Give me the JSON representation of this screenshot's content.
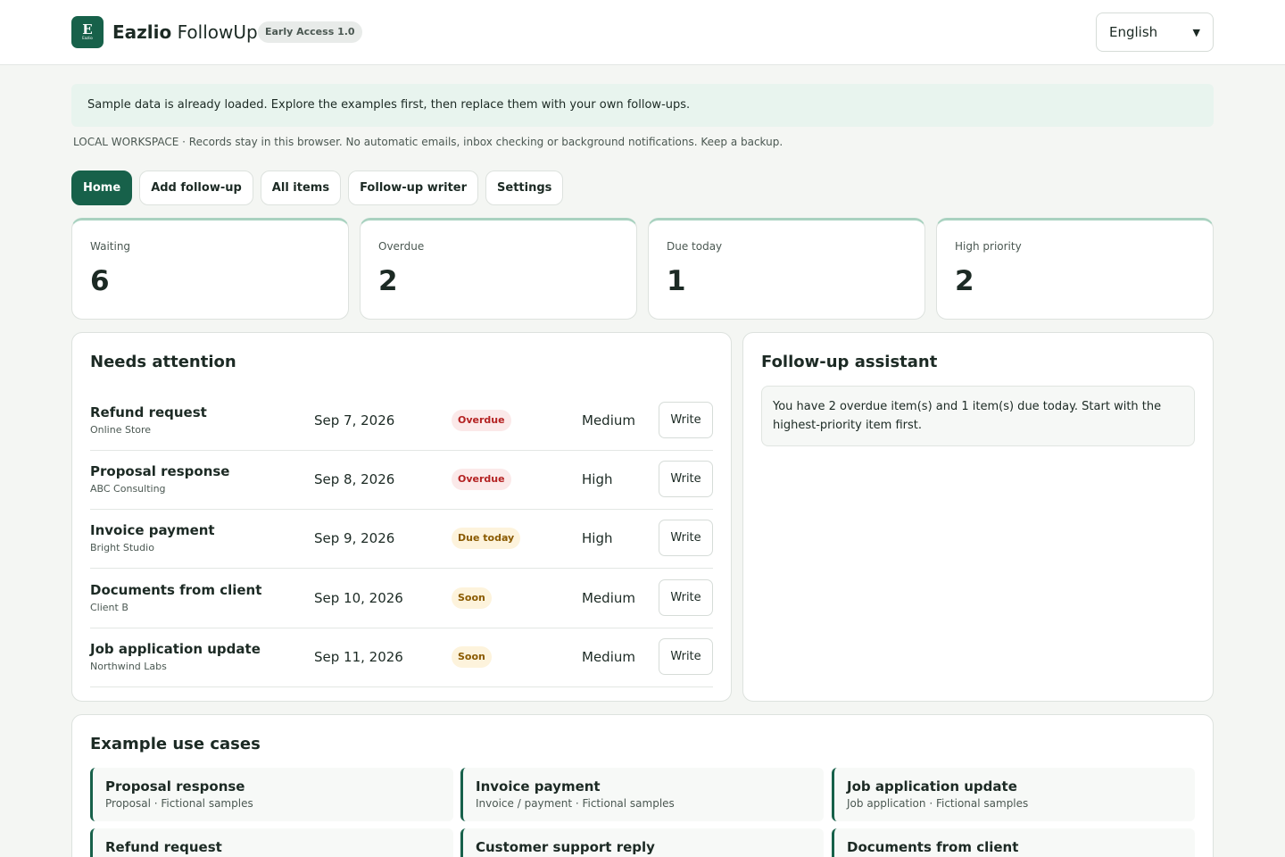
{
  "header": {
    "logo_letter": "E",
    "logo_sub": "Eazlio",
    "brand_bold": "Eazlio",
    "brand_rest": "FollowUp",
    "version_badge": "Early Access 1.0",
    "language": "English"
  },
  "notice": "Sample data is already loaded. Explore the examples first, then replace them with your own follow-ups.",
  "local_note": "LOCAL WORKSPACE · Records stay in this browser. No automatic emails, inbox checking or background notifications. Keep a backup.",
  "tabs": [
    {
      "label": "Home",
      "active": true
    },
    {
      "label": "Add follow-up",
      "active": false
    },
    {
      "label": "All items",
      "active": false
    },
    {
      "label": "Follow-up writer",
      "active": false
    },
    {
      "label": "Settings",
      "active": false
    }
  ],
  "stats": [
    {
      "label": "Waiting",
      "value": "6"
    },
    {
      "label": "Overdue",
      "value": "2"
    },
    {
      "label": "Due today",
      "value": "1"
    },
    {
      "label": "High priority",
      "value": "2"
    }
  ],
  "attention": {
    "title": "Needs attention",
    "write_label": "Write",
    "rows": [
      {
        "title": "Refund request",
        "sub": "Online Store",
        "date": "Sep 7, 2026",
        "status": "Overdue",
        "status_kind": "overdue",
        "priority": "Medium"
      },
      {
        "title": "Proposal response",
        "sub": "ABC Consulting",
        "date": "Sep 8, 2026",
        "status": "Overdue",
        "status_kind": "overdue",
        "priority": "High"
      },
      {
        "title": "Invoice payment",
        "sub": "Bright Studio",
        "date": "Sep 9, 2026",
        "status": "Due today",
        "status_kind": "duetoday",
        "priority": "High"
      },
      {
        "title": "Documents from client",
        "sub": "Client B",
        "date": "Sep 10, 2026",
        "status": "Soon",
        "status_kind": "soon",
        "priority": "Medium"
      },
      {
        "title": "Job application update",
        "sub": "Northwind Labs",
        "date": "Sep 11, 2026",
        "status": "Soon",
        "status_kind": "soon",
        "priority": "Medium"
      }
    ]
  },
  "assistant": {
    "title": "Follow-up assistant",
    "message": "You have 2 overdue item(s) and 1 item(s) due today. Start with the highest-priority item first."
  },
  "use_cases": {
    "title": "Example use cases",
    "items": [
      {
        "title": "Proposal response",
        "sub": "Proposal · Fictional samples"
      },
      {
        "title": "Invoice payment",
        "sub": "Invoice / payment · Fictional samples"
      },
      {
        "title": "Job application update",
        "sub": "Job application · Fictional samples"
      },
      {
        "title": "Refund request",
        "sub": ""
      },
      {
        "title": "Customer support reply",
        "sub": ""
      },
      {
        "title": "Documents from client",
        "sub": ""
      }
    ]
  },
  "colors": {
    "accent": "#17614a",
    "overdue": "#b42323",
    "warning": "#8a5a00"
  }
}
